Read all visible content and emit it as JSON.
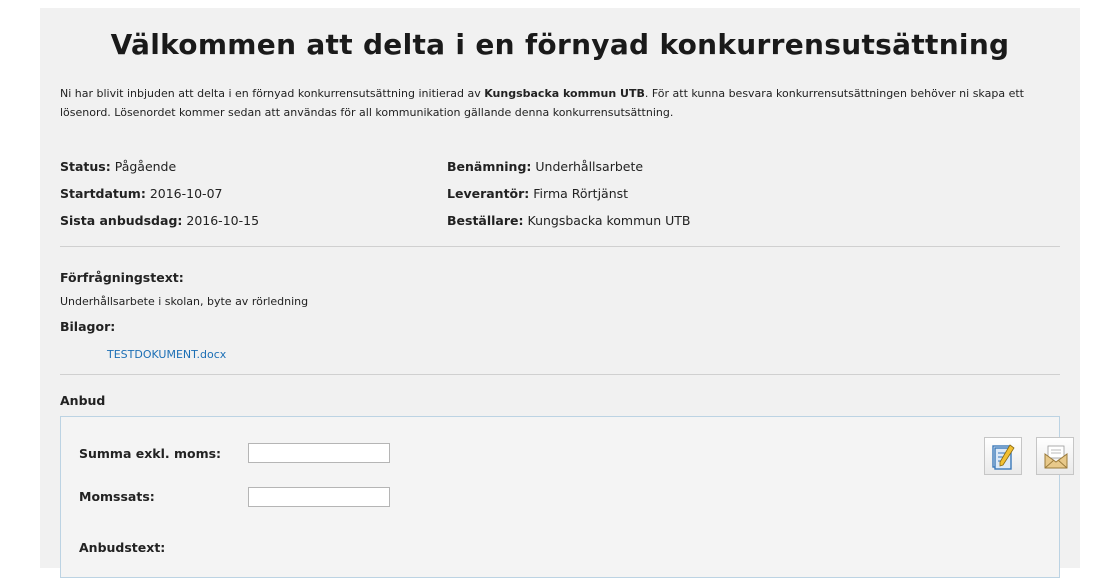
{
  "title": "Välkommen att delta i en förnyad konkurrensutsättning",
  "intro": {
    "part1": "Ni har blivit inbjuden att delta i en förnyad konkurrensutsättning initierad av ",
    "org": "Kungsbacka kommun UTB",
    "part2": ". För att kunna besvara konkurrensutsättningen behöver ni skapa ett lösenord. Lösenordet kommer sedan att användas för all kommunikation gällande denna konkurrensutsättning."
  },
  "details": {
    "status_label": "Status:",
    "status_value": "Pågående",
    "start_label": "Startdatum:",
    "start_value": "2016-10-07",
    "deadline_label": "Sista anbudsdag:",
    "deadline_value": "2016-10-15",
    "name_label": "Benämning:",
    "name_value": "Underhållsarbete",
    "supplier_label": "Leverantör:",
    "supplier_value": "Firma Rörtjänst",
    "orderer_label": "Beställare:",
    "orderer_value": "Kungsbacka kommun UTB"
  },
  "request": {
    "label": "Förfrågningstext:",
    "text": "Underhållsarbete i skolan, byte av rörledning",
    "attachments_label": "Bilagor:",
    "attachment": "TESTDOKUMENT.docx"
  },
  "bid": {
    "heading": "Anbud",
    "sum_label": "Summa exkl. moms:",
    "sum_value": "",
    "vat_label": "Momssats:",
    "vat_value": "",
    "text_label": "Anbudstext:"
  },
  "icons": {
    "edit": "edit-document-icon",
    "send": "send-mail-icon"
  },
  "colors": {
    "link": "#1c6fb5",
    "box_border": "#bcd3e3",
    "background": "#f1f1f1"
  }
}
